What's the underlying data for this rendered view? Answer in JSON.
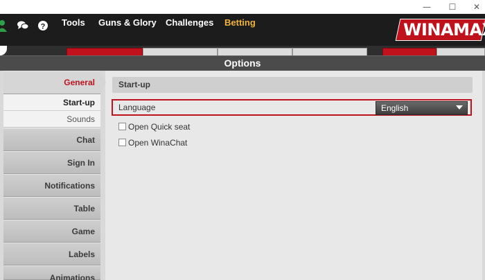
{
  "window": {
    "minimize_glyph": "—",
    "maximize_glyph": "☐",
    "close_glyph": "✕"
  },
  "nav": {
    "items": [
      {
        "label": "Tools"
      },
      {
        "label": "Guns & Glory"
      },
      {
        "label": "Challenges"
      },
      {
        "label": "Betting",
        "accent": "#f0b43c"
      }
    ],
    "icons": [
      "poker-player-icon",
      "chat-bubbles-icon",
      "help-icon"
    ]
  },
  "logo": {
    "text": "WINAMAX",
    "color": "#c0121c"
  },
  "options": {
    "title": "Options",
    "sidebar": {
      "items": [
        {
          "label": "General",
          "active": true
        },
        {
          "label": "Start-up",
          "sub": true,
          "selected": true
        },
        {
          "label": "Sounds",
          "sub": true
        },
        {
          "label": "Chat"
        },
        {
          "label": "Sign In"
        },
        {
          "label": "Notifications"
        },
        {
          "label": "Table"
        },
        {
          "label": "Game"
        },
        {
          "label": "Labels"
        },
        {
          "label": "Animations"
        }
      ]
    },
    "section": {
      "title": "Start-up",
      "language": {
        "label": "Language",
        "value": "English"
      },
      "checkboxes": [
        {
          "label": "Open Quick seat",
          "checked": false
        },
        {
          "label": "Open WinaChat",
          "checked": false
        }
      ]
    }
  },
  "colors": {
    "accent_red": "#c0121c",
    "nav_bg": "#1c1c1c",
    "betting": "#f0b43c"
  }
}
